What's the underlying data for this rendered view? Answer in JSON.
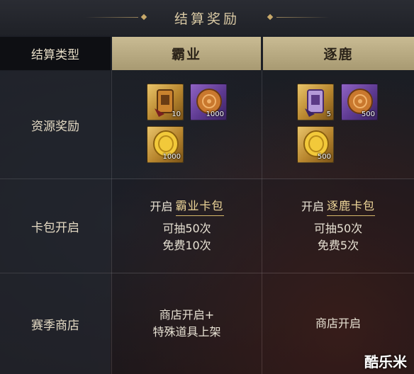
{
  "header": {
    "title": "结算奖励"
  },
  "table": {
    "type_header": "结算类型",
    "columns": [
      "霸业",
      "逐鹿"
    ],
    "rows": {
      "resources": {
        "label": "资源奖励"
      },
      "cardpack": {
        "label": "卡包开启"
      },
      "shop": {
        "label": "赛季商店"
      }
    }
  },
  "col1": {
    "rewards": [
      {
        "icon": "token-badge-icon",
        "qty": "10"
      },
      {
        "icon": "mooncake-icon",
        "qty": "1000"
      },
      {
        "icon": "gold-coin-icon",
        "qty": "1000"
      }
    ],
    "open_prefix": "开启",
    "open_link": "霸业卡包",
    "draws": "可抽50次",
    "free": "免费10次",
    "shop_line1": "商店开启+",
    "shop_line2": "特殊道具上架"
  },
  "col2": {
    "rewards": [
      {
        "icon": "token-badge-icon",
        "qty": "5"
      },
      {
        "icon": "mooncake-icon",
        "qty": "500"
      },
      {
        "icon": "gold-coin-icon",
        "qty": "500"
      }
    ],
    "open_prefix": "开启",
    "open_link": "逐鹿卡包",
    "draws": "可抽50次",
    "free": "免费5次",
    "shop_line1": "商店开启"
  },
  "watermark": "酷乐米",
  "colors": {
    "header_gold": "#c9bb93",
    "accent_text": "#f0d89a"
  }
}
